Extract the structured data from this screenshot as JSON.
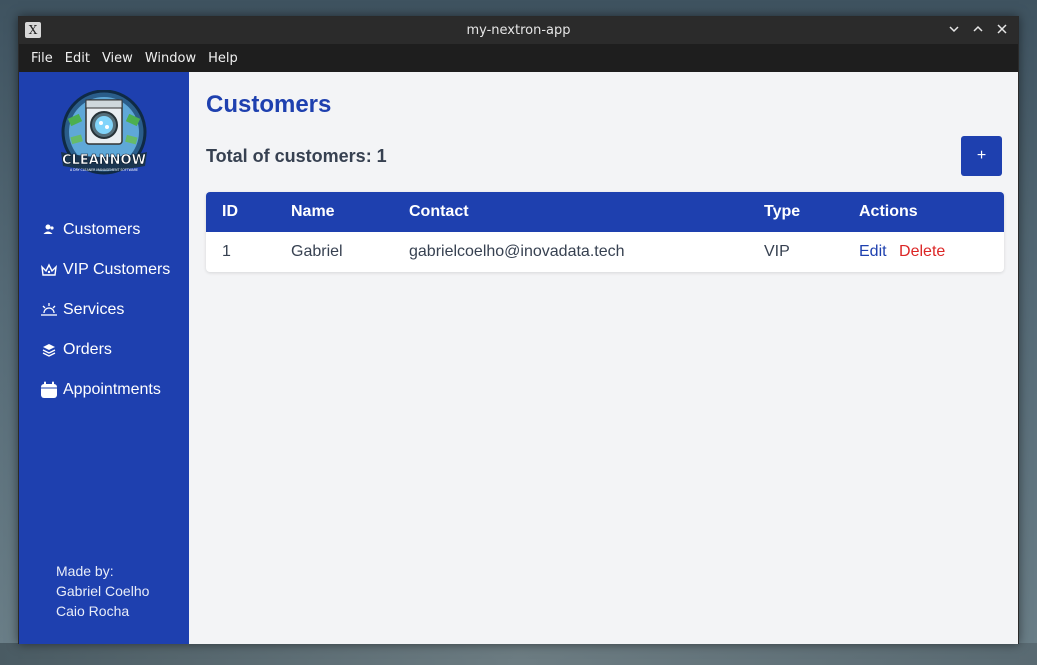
{
  "window": {
    "title": "my-nextron-app",
    "app_icon": "X"
  },
  "menubar": [
    "File",
    "Edit",
    "View",
    "Window",
    "Help"
  ],
  "sidebar": {
    "logo_text": "CLEANNOW",
    "logo_subtitle": "A DRY CLEANER MANAGEMENT SOFTWARE",
    "items": [
      {
        "label": "Customers",
        "icon": "users-icon"
      },
      {
        "label": "VIP Customers",
        "icon": "crown-icon"
      },
      {
        "label": "Services",
        "icon": "sunrise-icon"
      },
      {
        "label": "Orders",
        "icon": "layers-icon"
      },
      {
        "label": "Appointments",
        "icon": "calendar-icon"
      }
    ],
    "credits": {
      "heading": "Made by:",
      "names": [
        "Gabriel Coelho",
        "Caio Rocha"
      ]
    }
  },
  "main": {
    "title": "Customers",
    "total_label": "Total of customers: 1",
    "add_label": "+",
    "table": {
      "headers": [
        "ID",
        "Name",
        "Contact",
        "Type",
        "Actions"
      ],
      "rows": [
        {
          "id": "1",
          "name": "Gabriel",
          "contact": "gabrielcoelho@inovadata.tech",
          "type": "VIP"
        }
      ],
      "edit_label": "Edit",
      "delete_label": "Delete"
    }
  },
  "colors": {
    "primary": "#1e40af",
    "danger": "#dc2626",
    "background": "#f3f4f6"
  }
}
